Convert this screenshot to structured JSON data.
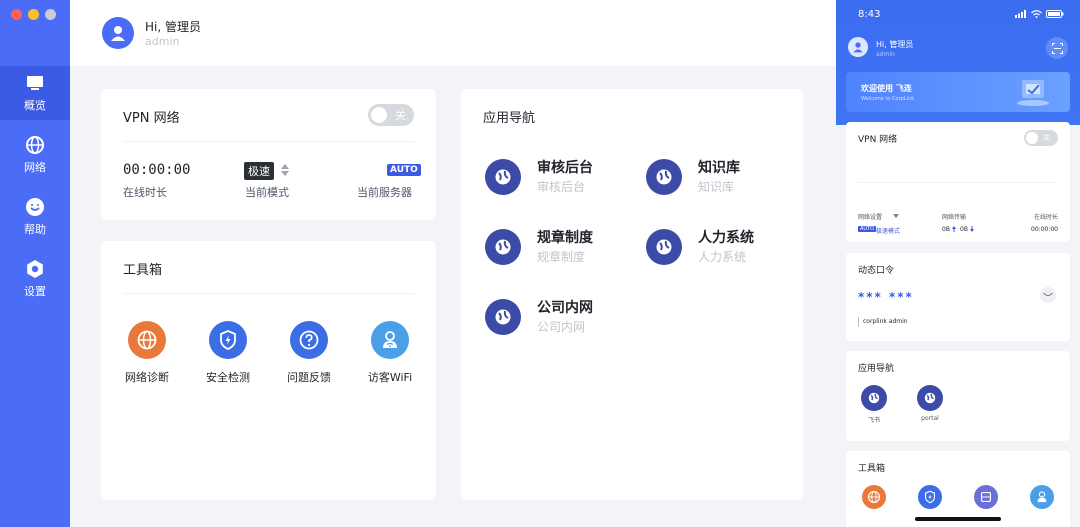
{
  "sidebar": {
    "items": [
      {
        "label": "概览",
        "icon": "monitor-icon",
        "active": true
      },
      {
        "label": "网络",
        "icon": "globe-icon",
        "active": false
      },
      {
        "label": "帮助",
        "icon": "help-icon",
        "active": false
      },
      {
        "label": "设置",
        "icon": "gear-icon",
        "active": false
      }
    ]
  },
  "header": {
    "greeting": "Hi, 管理员",
    "username": "admin"
  },
  "vpn": {
    "title": "VPN 网络",
    "toggle_label": "关",
    "online_time_value": "00:00:00",
    "online_time_label": "在线时长",
    "mode_value": "极速",
    "mode_label": "当前模式",
    "server_value": "AUTO",
    "server_label": "当前服务器"
  },
  "toolbox": {
    "title": "工具箱",
    "tools": [
      {
        "label": "网络诊断",
        "icon": "globe-icon",
        "color": "#e8793a"
      },
      {
        "label": "安全检测",
        "icon": "shield-icon",
        "color": "#3b6de6"
      },
      {
        "label": "问题反馈",
        "icon": "question-icon",
        "color": "#3b6de6"
      },
      {
        "label": "访客WiFi",
        "icon": "wifi-person-icon",
        "color": "#4a9fe8"
      }
    ]
  },
  "app_nav": {
    "title": "应用导航",
    "apps": [
      {
        "name": "审核后台",
        "sub": "审核后台"
      },
      {
        "name": "知识库",
        "sub": "知识库"
      },
      {
        "name": "规章制度",
        "sub": "规章制度"
      },
      {
        "name": "人力系统",
        "sub": "人力系统"
      },
      {
        "name": "公司内网",
        "sub": "公司内网"
      }
    ]
  },
  "phone": {
    "time": "8:43",
    "greeting": "Hi, 管理员",
    "username": "admin",
    "banner_title": "欢迎使用 飞连",
    "banner_sub": "Welcome to CorpLink",
    "vpn_title": "VPN 网络",
    "vpn_toggle": "关",
    "net_setting_label": "网络设置",
    "net_transfer_label": "网络传输",
    "online_label": "在线时长",
    "auto": "AUTO",
    "mode": "极速模式",
    "transfer_up": "0B",
    "transfer_down": "0B",
    "online_value": "00:00:00",
    "otp_title": "动态口令",
    "otp_value": "*** ***",
    "otp_account": "corplink admin",
    "apps_title": "应用导航",
    "apps": [
      {
        "name": "飞书"
      },
      {
        "name": "portal"
      }
    ],
    "tools_title": "工具箱",
    "tool_colors": [
      "#e8793a",
      "#3b6de6",
      "#6b6fd6",
      "#4a9fe8"
    ]
  }
}
